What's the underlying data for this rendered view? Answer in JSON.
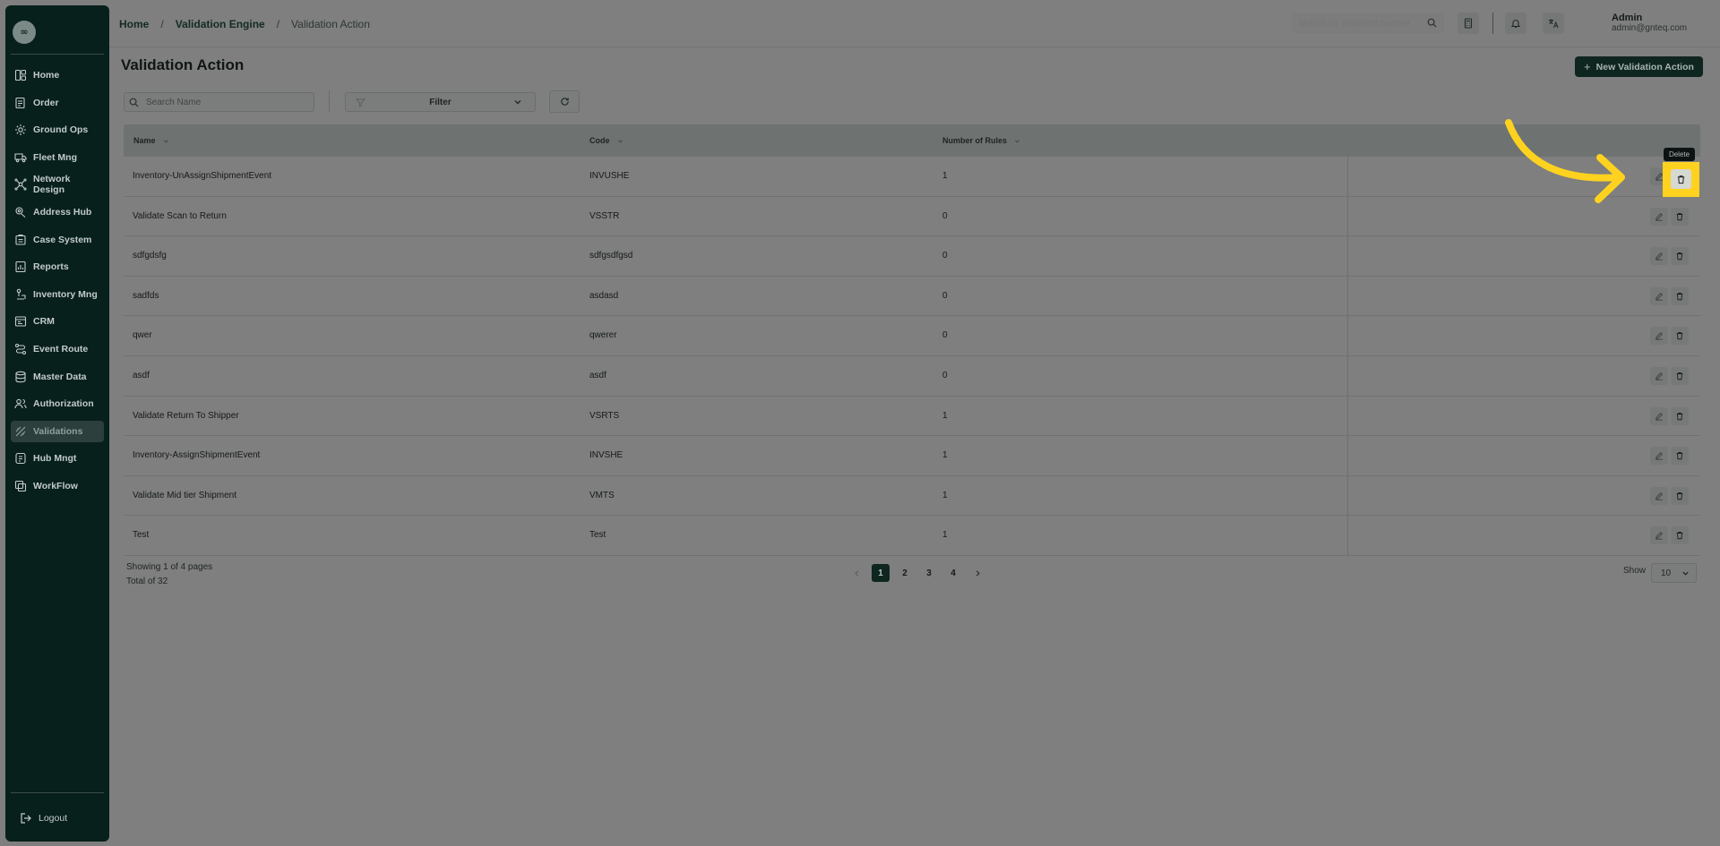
{
  "app": {
    "logo_text": "∞"
  },
  "sidebar": {
    "items": [
      {
        "label": "Home",
        "icon": "home-grid-icon"
      },
      {
        "label": "Order",
        "icon": "order-icon"
      },
      {
        "label": "Ground Ops",
        "icon": "ground-ops-icon"
      },
      {
        "label": "Fleet Mng",
        "icon": "truck-icon"
      },
      {
        "label": "Network Design",
        "icon": "network-icon"
      },
      {
        "label": "Address Hub",
        "icon": "location-icon"
      },
      {
        "label": "Case System",
        "icon": "case-icon"
      },
      {
        "label": "Reports",
        "icon": "report-icon"
      },
      {
        "label": "Inventory Mng",
        "icon": "inventory-icon"
      },
      {
        "label": "CRM",
        "icon": "crm-icon"
      },
      {
        "label": "Event Route",
        "icon": "route-icon"
      },
      {
        "label": "Master Data",
        "icon": "database-icon"
      },
      {
        "label": "Authorization",
        "icon": "users-icon"
      },
      {
        "label": "Validations",
        "icon": "validation-icon",
        "active": true
      },
      {
        "label": "Hub Mngt",
        "icon": "hub-icon"
      },
      {
        "label": "WorkFlow",
        "icon": "workflow-icon"
      }
    ],
    "logout_label": "Logout"
  },
  "header": {
    "breadcrumb": [
      "Home",
      "Validation Engine",
      "Validation Action"
    ],
    "separator": "/",
    "search_placeholder": "search for shipment number",
    "user_name": "Admin",
    "user_email": "admin@gnteq.com"
  },
  "main": {
    "title": "Validation Action",
    "new_button_label": "New Validation Action",
    "search_placeholder": "Search Name",
    "filter_label": "Filter",
    "columns": [
      "Name",
      "Code",
      "Number of Rules"
    ],
    "rows": [
      {
        "name": "Inventory-UnAssignShipmentEvent",
        "code": "INVUSHE",
        "rules": "1"
      },
      {
        "name": "Validate Scan to Return",
        "code": "VSSTR",
        "rules": "0"
      },
      {
        "name": "sdfgdsfg",
        "code": "sdfgsdfgsd",
        "rules": "0"
      },
      {
        "name": "sadfds",
        "code": "asdasd",
        "rules": "0"
      },
      {
        "name": "qwer",
        "code": "qwerer",
        "rules": "0"
      },
      {
        "name": "asdf",
        "code": "asdf",
        "rules": "0"
      },
      {
        "name": "Validate Return To Shipper",
        "code": "VSRTS",
        "rules": "1"
      },
      {
        "name": "Inventory-AssignShipmentEvent",
        "code": "INVSHE",
        "rules": "1"
      },
      {
        "name": "Validate Mid tier Shipment",
        "code": "VMTS",
        "rules": "1"
      },
      {
        "name": "Test",
        "code": "Test",
        "rules": "1"
      }
    ],
    "tooltip": "Delete",
    "footer": {
      "showing": "Showing 1 of 4 pages",
      "total": "Total of 32",
      "pages": [
        "1",
        "2",
        "3",
        "4"
      ],
      "current_page": "1",
      "show_label": "Show",
      "page_size": "10"
    }
  },
  "colors": {
    "accent": "#0f2520",
    "highlight": "#ffd21f",
    "overlay": "#7e7f7e"
  }
}
